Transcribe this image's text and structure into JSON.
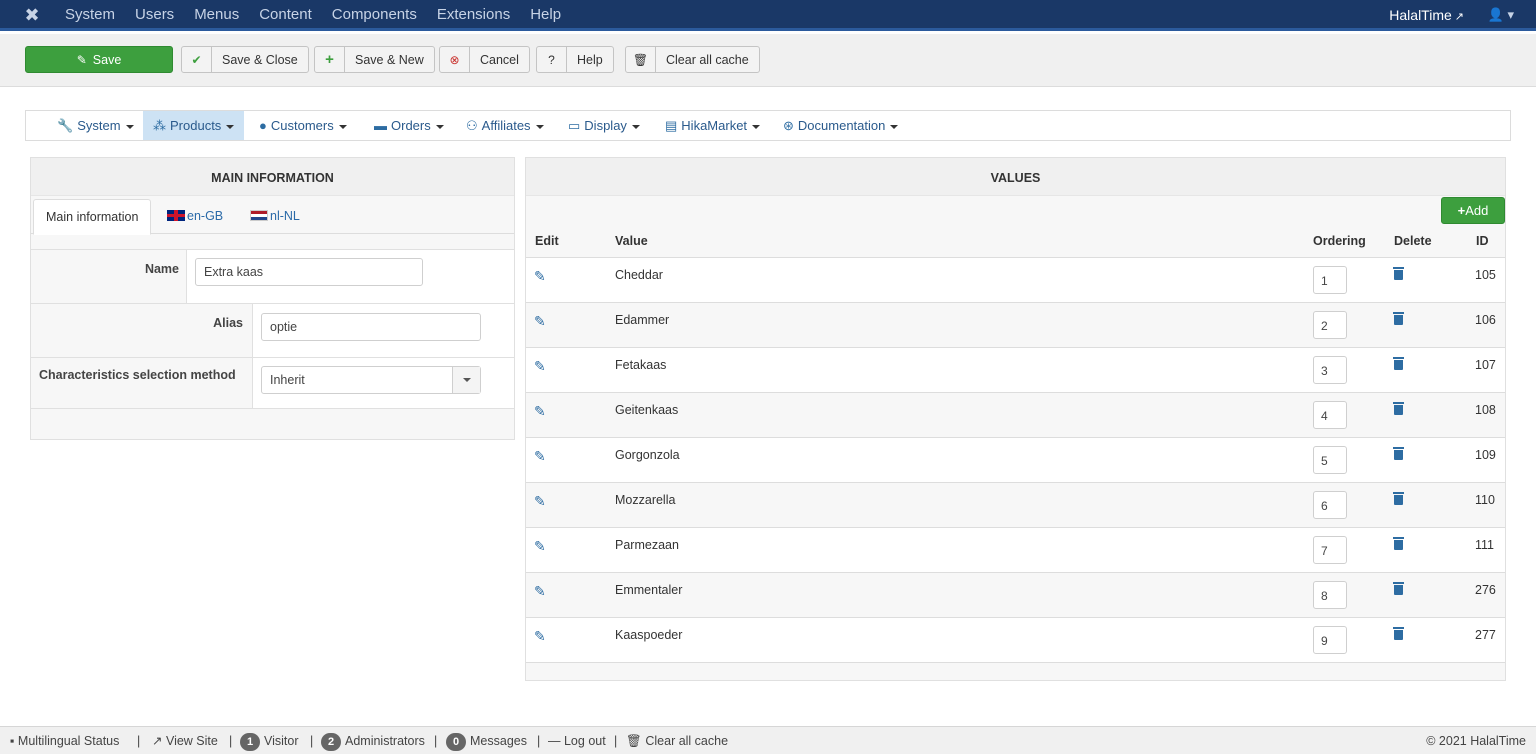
{
  "topbar": {
    "menu": [
      "System",
      "Users",
      "Menus",
      "Content",
      "Components",
      "Extensions",
      "Help"
    ],
    "site_name": "HalalTime"
  },
  "toolbar": {
    "save": "Save",
    "save_close": "Save & Close",
    "save_new": "Save & New",
    "cancel": "Cancel",
    "help": "Help",
    "clear_cache": "Clear all cache"
  },
  "hikamenu": {
    "items": [
      "System",
      "Products",
      "Customers",
      "Orders",
      "Affiliates",
      "Display",
      "HikaMarket",
      "Documentation"
    ],
    "active": "Products"
  },
  "main_info": {
    "heading": "MAIN INFORMATION",
    "tabs": [
      "Main information",
      "en-GB",
      "nl-NL"
    ],
    "name_label": "Name",
    "name_value": "Extra kaas",
    "alias_label": "Alias",
    "alias_value": "optie",
    "method_label": "Characteristics selection method",
    "method_value": "Inherit"
  },
  "values": {
    "heading": "VALUES",
    "add_label": "Add",
    "columns": [
      "Edit",
      "Value",
      "Ordering",
      "Delete",
      "ID"
    ],
    "rows": [
      {
        "value": "Cheddar",
        "ordering": "1",
        "id": "105"
      },
      {
        "value": "Edammer",
        "ordering": "2",
        "id": "106"
      },
      {
        "value": "Fetakaas",
        "ordering": "3",
        "id": "107"
      },
      {
        "value": "Geitenkaas",
        "ordering": "4",
        "id": "108"
      },
      {
        "value": "Gorgonzola",
        "ordering": "5",
        "id": "109"
      },
      {
        "value": "Mozzarella",
        "ordering": "6",
        "id": "110"
      },
      {
        "value": "Parmezaan",
        "ordering": "7",
        "id": "111"
      },
      {
        "value": "Emmentaler",
        "ordering": "8",
        "id": "276"
      },
      {
        "value": "Kaaspoeder",
        "ordering": "9",
        "id": "277"
      }
    ]
  },
  "statusbar": {
    "multilingual": "Multilingual Status",
    "view_site": "View Site",
    "visitor_count": "1",
    "visitor_label": "Visitor",
    "admin_count": "2",
    "admin_label": "Administrators",
    "messages_count": "0",
    "messages_label": "Messages",
    "logout": "Log out",
    "clear_cache": "Clear all cache",
    "copyright": "© 2021 HalalTime"
  },
  "colors": {
    "topbar": "#1a3867",
    "accent_green": "#3d9f3e",
    "link_blue": "#2d6ca2"
  }
}
